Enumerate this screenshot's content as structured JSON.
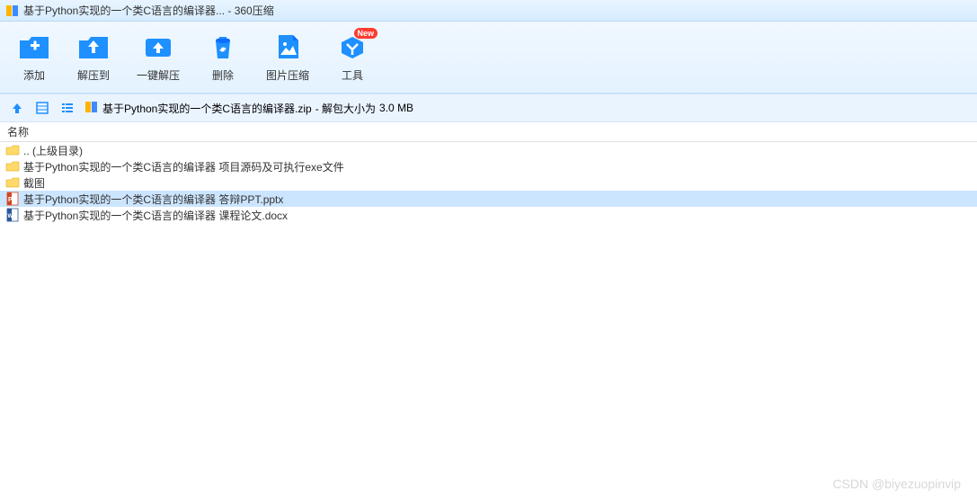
{
  "titlebar": {
    "title": "基于Python实现的一个类C语言的编译器... - 360压缩"
  },
  "toolbar": {
    "items": [
      {
        "label": "添加",
        "icon": "add-icon"
      },
      {
        "label": "解压到",
        "icon": "extract-to-icon"
      },
      {
        "label": "一键解压",
        "icon": "one-click-extract-icon"
      },
      {
        "label": "删除",
        "icon": "delete-icon"
      },
      {
        "label": "图片压缩",
        "icon": "image-compress-icon"
      },
      {
        "label": "工具",
        "icon": "tools-icon",
        "badge": "New"
      }
    ]
  },
  "navbar": {
    "archive_name": "基于Python实现的一个类C语言的编译器.zip",
    "size_prefix": " - 解包大小为 ",
    "size_value": "3.0 MB"
  },
  "columns": {
    "name": "名称"
  },
  "files": [
    {
      "name": ".. (上级目录)",
      "type": "up-folder"
    },
    {
      "name": "基于Python实现的一个类C语言的编译器 项目源码及可执行exe文件",
      "type": "folder"
    },
    {
      "name": "截图",
      "type": "folder"
    },
    {
      "name": "基于Python实现的一个类C语言的编译器 答辩PPT.pptx",
      "type": "pptx",
      "selected": true
    },
    {
      "name": "基于Python实现的一个类C语言的编译器 课程论文.docx",
      "type": "docx"
    }
  ],
  "watermark": "CSDN @biyezuopinvip"
}
